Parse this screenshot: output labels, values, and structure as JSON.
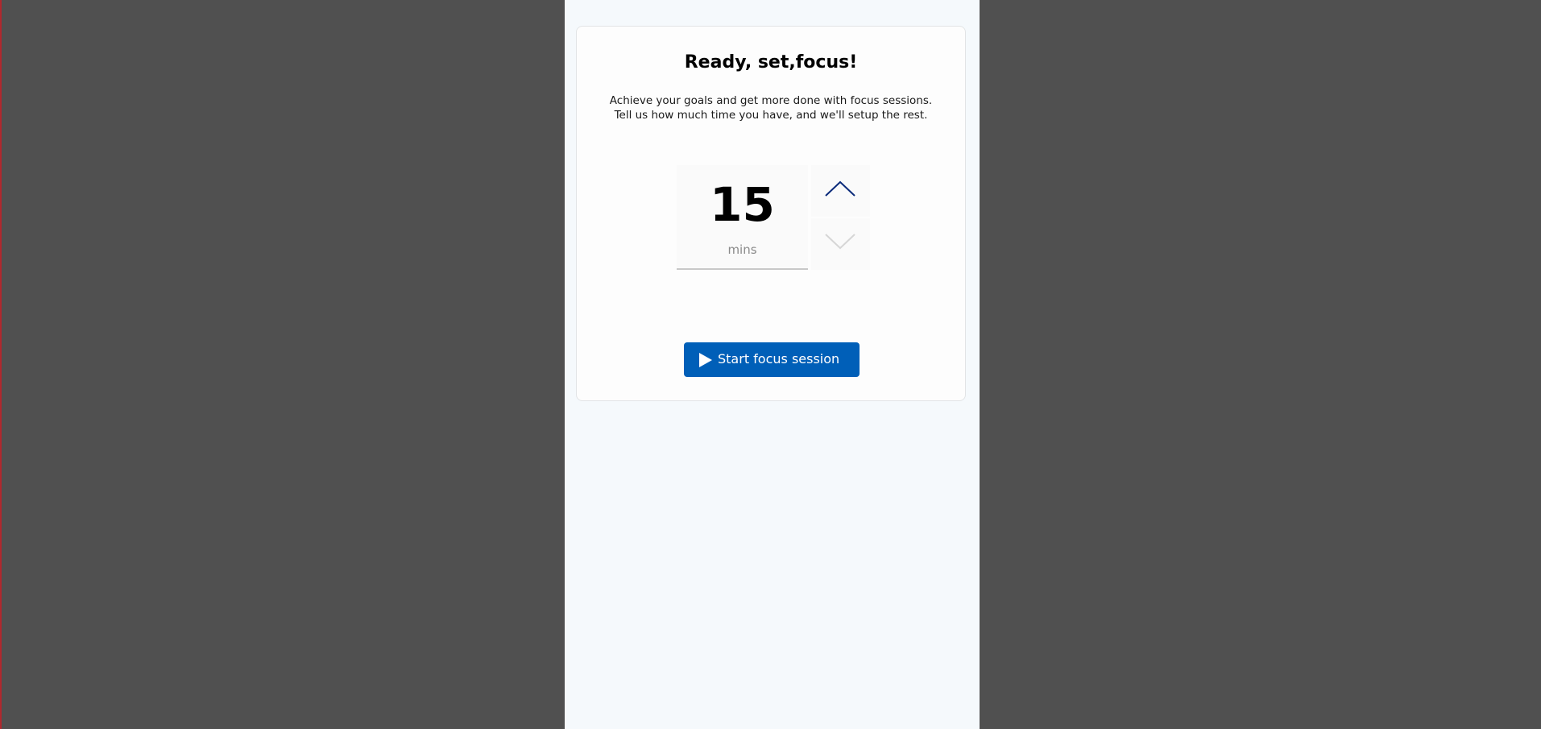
{
  "focus": {
    "title": "Ready, set,focus!",
    "description_line1": "Achieve your goals and get more done with focus sessions.",
    "description_line2": "Tell us how much time you have, and we'll setup the rest.",
    "time_value": "15",
    "time_unit": "mins",
    "increase_icon": "chevron-up-icon",
    "decrease_icon": "chevron-down-icon",
    "start_button_label": "Start focus session",
    "start_button_icon": "play-icon"
  },
  "colors": {
    "accent": "#005fb8",
    "chevron_active": "#0a2a7a",
    "chevron_disabled": "#d6d6d6",
    "background_outer": "#505050",
    "panel_background": "#f5f9fc"
  }
}
